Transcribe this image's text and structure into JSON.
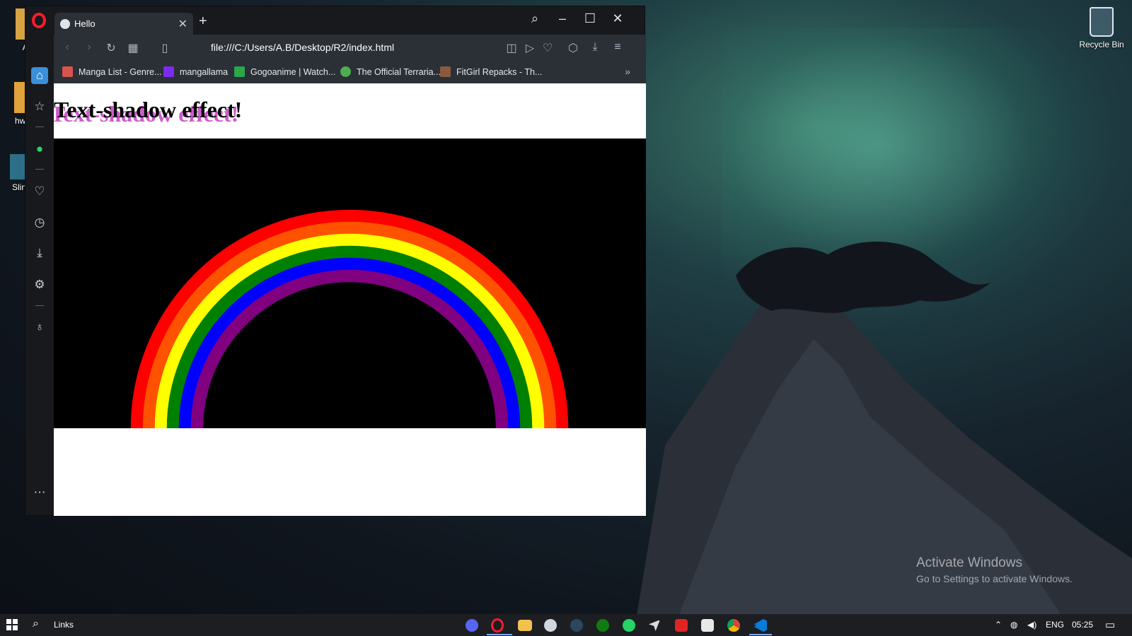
{
  "desktop": {
    "icons": [
      {
        "label": "Ap",
        "icon": "folder-icon"
      },
      {
        "label": "hwmo",
        "icon": "folder-icon"
      },
      {
        "label": "Slin",
        "icon": "shortcut-icon"
      }
    ],
    "recycle_bin": {
      "label": "Recycle Bin",
      "icon": "recycle-bin-icon"
    },
    "watermark": {
      "title": "Activate Windows",
      "subtitle": "Go to Settings to activate Windows."
    }
  },
  "browser": {
    "tab": {
      "title": "Hello",
      "icon": "globe-icon"
    },
    "address": "file:///C:/Users/A.B/Desktop/R2/index.html",
    "bookmarks": [
      {
        "label": "Manga List - Genre...",
        "color": "#d9534f"
      },
      {
        "label": "mangallama",
        "color": "#7b2cf0"
      },
      {
        "label": "Gogoanime | Watch...",
        "color": "#2aa84a"
      },
      {
        "label": "The Official Terraria...",
        "color": "#4cae4c"
      },
      {
        "label": "FitGirl Repacks - Th...",
        "color": "#8a5a3c"
      }
    ],
    "sidebar": [
      "home-icon",
      "star-icon",
      "whatsapp-icon",
      "heart-icon",
      "history-icon",
      "download-icon",
      "settings-icon",
      "lightbulb-icon",
      "more-icon"
    ]
  },
  "page": {
    "heading": "Text-shadow effect!",
    "shadow_color": "#c84ac8",
    "rainbow_colors": [
      "#ff0000",
      "#ff5200",
      "#ffff00",
      "#008000",
      "#0000ff",
      "#800080"
    ]
  },
  "taskbar": {
    "links_label": "Links",
    "language": "ENG",
    "time": "05:25"
  },
  "colors": {
    "accent": "#3a8fd8",
    "opera_red": "#ff1b2d"
  }
}
